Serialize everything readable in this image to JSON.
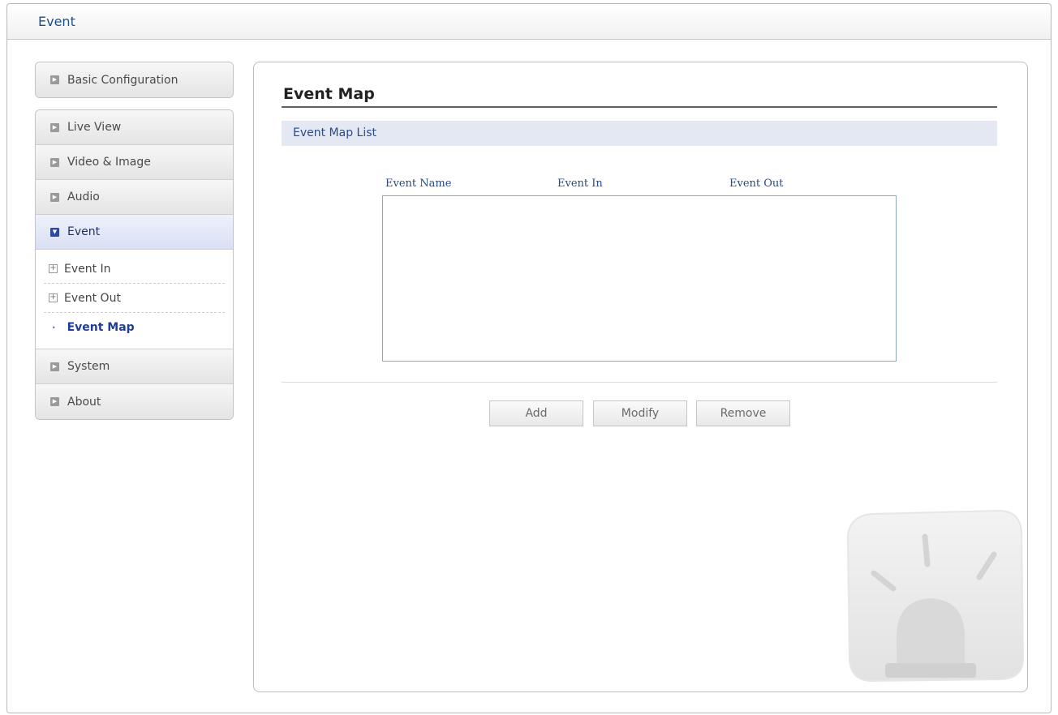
{
  "header": {
    "title": "Event"
  },
  "sidebar": {
    "top_item": {
      "label": "Basic Configuration"
    },
    "items": [
      {
        "label": "Live View"
      },
      {
        "label": "Video & Image"
      },
      {
        "label": "Audio"
      },
      {
        "label": "Event"
      },
      {
        "label": "System"
      },
      {
        "label": "About"
      }
    ],
    "event_sub_items": [
      {
        "label": "Event In"
      },
      {
        "label": "Event Out"
      },
      {
        "label": "Event Map"
      }
    ]
  },
  "main": {
    "title": "Event Map",
    "section_label": "Event Map List",
    "columns": [
      "Event Name",
      "Event In",
      "Event Out"
    ],
    "rows": [],
    "buttons": {
      "add": "Add",
      "modify": "Modify",
      "remove": "Remove"
    }
  },
  "colors": {
    "accent": "#1f4d8c",
    "active_nav": "#d9e0f4",
    "section_bar": "#e3e8f3"
  },
  "icons": {
    "collapsed_nav": "chevron-right-icon",
    "expanded_nav": "chevron-down-icon",
    "sub_item": "plus-box-icon",
    "watermark": "alarm-light-icon"
  }
}
